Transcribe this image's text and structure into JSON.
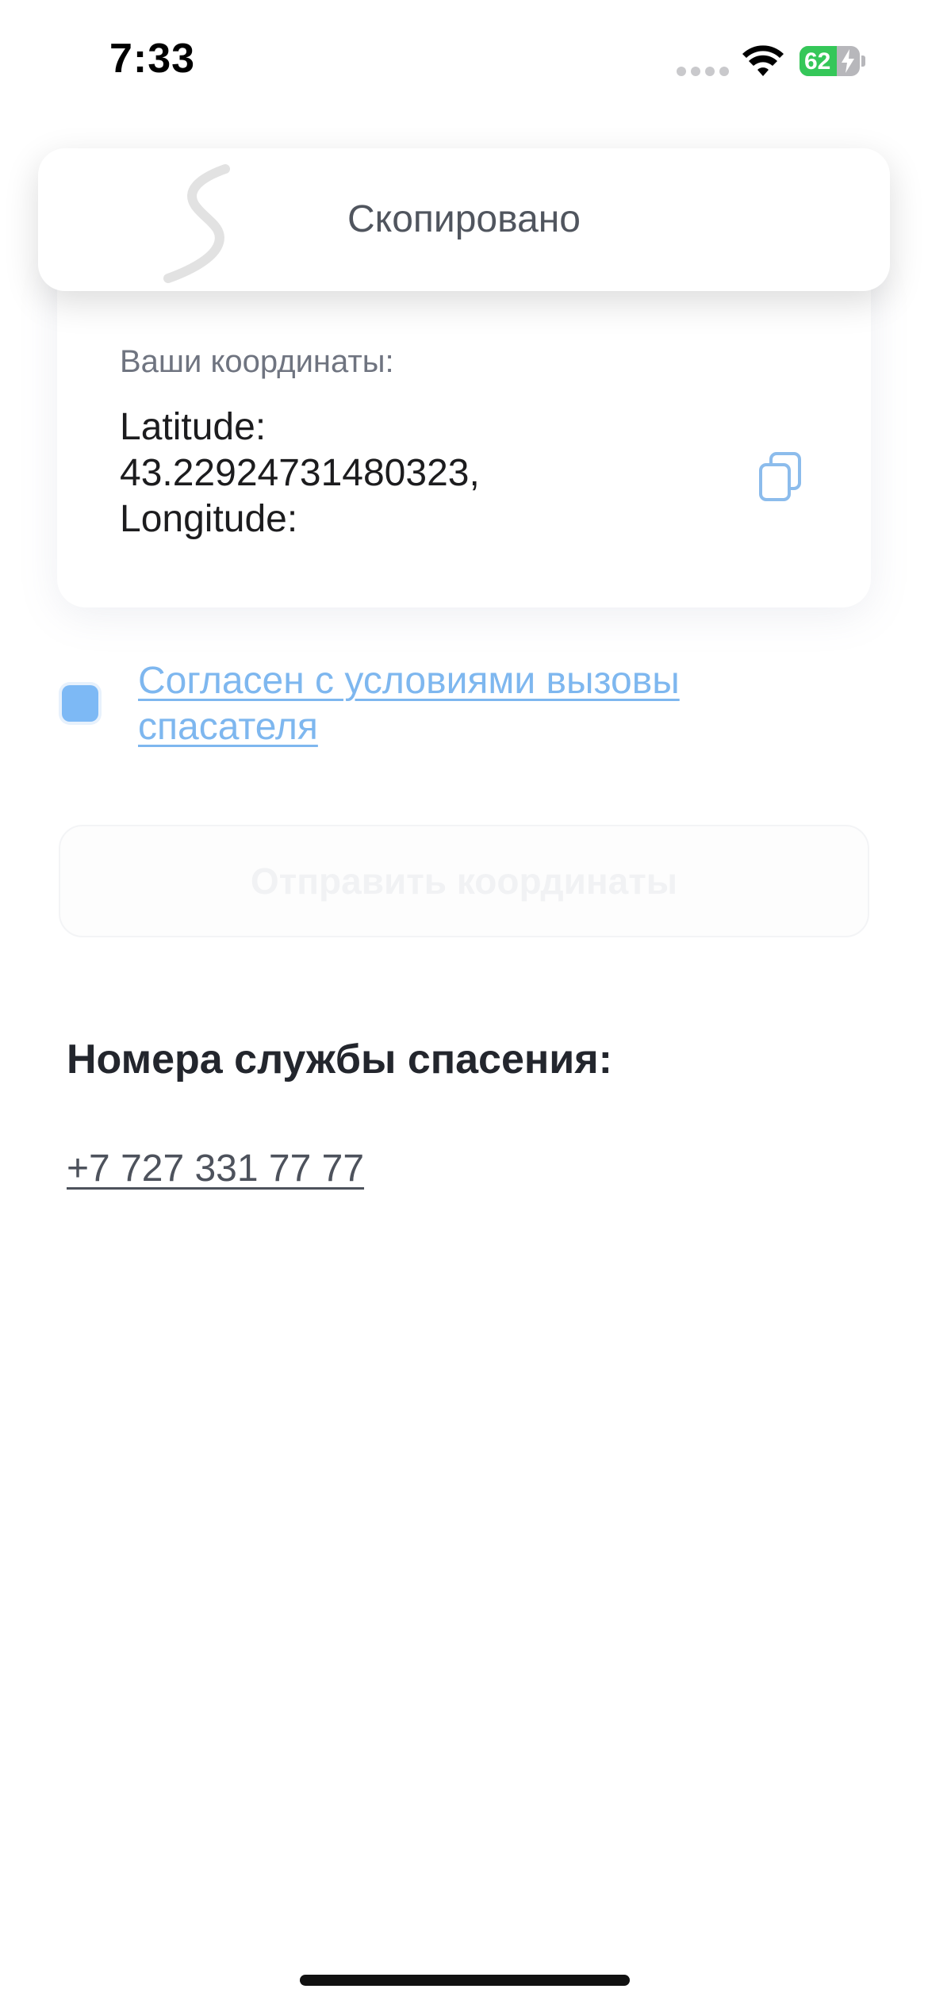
{
  "status_bar": {
    "time": "7:33",
    "battery_percent": "62",
    "battery_level": 0.62
  },
  "toast": {
    "message": "Скопировано"
  },
  "coordinates": {
    "label": "Ваши координаты:",
    "value": "Latitude:\n43.22924731480323,\nLongitude:"
  },
  "agreement": {
    "checked": true,
    "link_text": "Согласен с условиями вызовы спасателя"
  },
  "send_button": {
    "label": "Отправить координаты"
  },
  "rescue": {
    "heading": "Номера службы спасения:",
    "phones": [
      "+7 727 331 77 77"
    ]
  },
  "colors": {
    "accent": "#7db9f5",
    "link": "#7eb7ef",
    "battery_green": "#35c759"
  },
  "icons": {
    "copy": "copy-icon",
    "wifi": "wifi-icon",
    "charging": "bolt-icon",
    "logo": "logo-icon"
  }
}
